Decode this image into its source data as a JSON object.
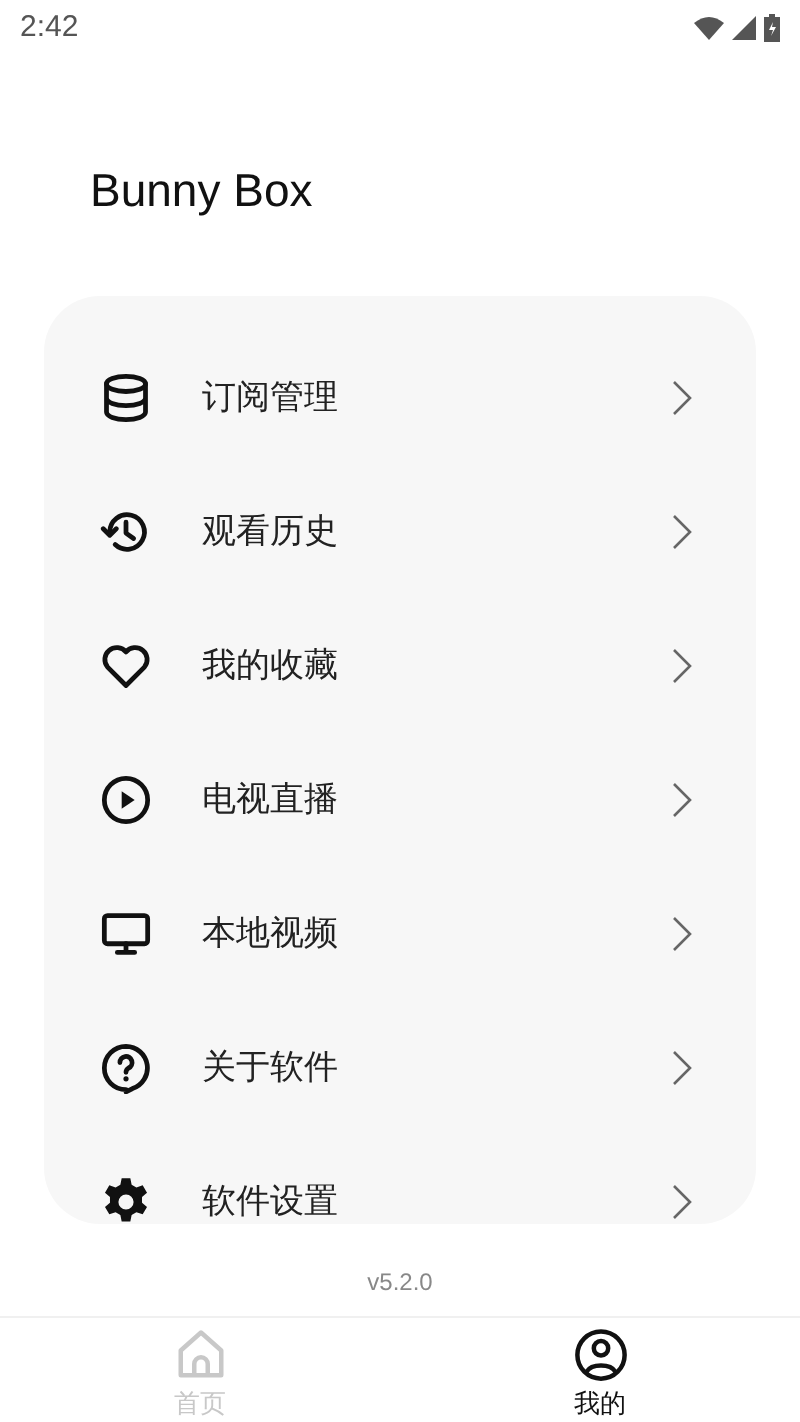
{
  "status_bar": {
    "time": "2:42"
  },
  "title": "Bunny Box",
  "menu": [
    {
      "kind": "database",
      "label": "订阅管理"
    },
    {
      "kind": "history",
      "label": "观看历史"
    },
    {
      "kind": "heart",
      "label": "我的收藏"
    },
    {
      "kind": "play",
      "label": "电视直播"
    },
    {
      "kind": "monitor",
      "label": "本地视频"
    },
    {
      "kind": "help",
      "label": "关于软件"
    },
    {
      "kind": "gear",
      "label": "软件设置"
    }
  ],
  "version": "v5.2.0",
  "bottom_nav": [
    {
      "kind": "home",
      "label": "首页",
      "selected": false
    },
    {
      "kind": "person",
      "label": "我的",
      "selected": true
    }
  ]
}
